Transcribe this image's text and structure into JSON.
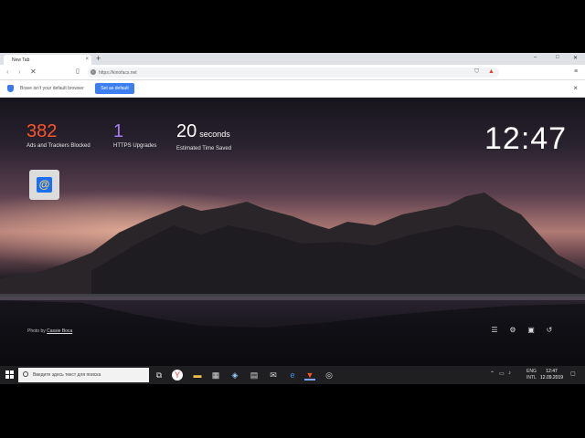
{
  "browser": {
    "tab_title": "New Tab",
    "tab_close": "×",
    "new_tab": "+",
    "url": "https://kinofacs.net",
    "window_controls": [
      "–",
      "□",
      "✕"
    ],
    "menu": "≡"
  },
  "infobar": {
    "message": "Brave isn't your default browser",
    "button": "Set as default",
    "close": "×"
  },
  "stats": {
    "ads": {
      "value": "382",
      "label": "Ads and Trackers Blocked",
      "color": "#fb542b"
    },
    "https": {
      "value": "1",
      "label": "HTTPS Upgrades",
      "color": "#a0a5eb"
    },
    "time": {
      "value": "20",
      "unit": "seconds",
      "label": "Estimated Time Saved"
    }
  },
  "clock": "12:47",
  "credit": {
    "prefix": "Photo by",
    "author": "Cassie Boca"
  },
  "controls": [
    "settings-sliders-icon",
    "gear-icon",
    "save-icon",
    "history-icon"
  ],
  "taskbar": {
    "search_placeholder": "Введите здесь текст для поиска",
    "lang": "ENG",
    "layout": "INTL",
    "time": "12:47",
    "date": "12.09.2019"
  }
}
